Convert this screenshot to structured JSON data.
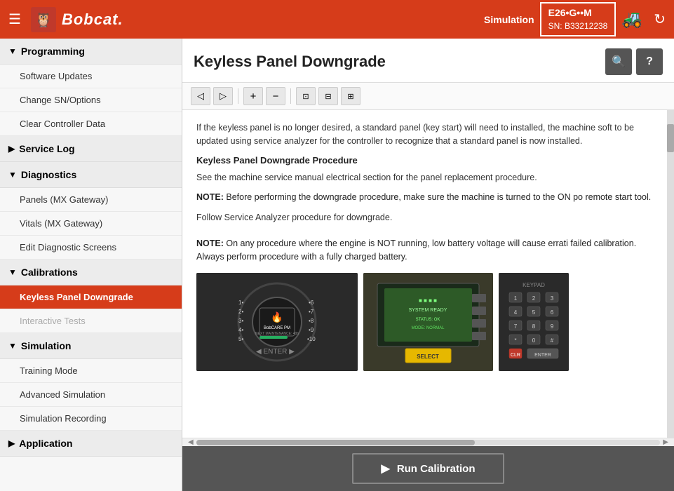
{
  "header": {
    "menu_label": "☰",
    "logo_text": "Bobcat.",
    "sim_label": "Simulation",
    "machine_model": "E26•G••M",
    "machine_sn": "SN: B33212238",
    "refresh_icon": "↻"
  },
  "sidebar": {
    "sections": [
      {
        "id": "programming",
        "label": "Programming",
        "expanded": true,
        "items": [
          {
            "id": "software-updates",
            "label": "Software Updates",
            "active": false,
            "disabled": false
          },
          {
            "id": "change-sn-options",
            "label": "Change SN/Options",
            "active": false,
            "disabled": false
          },
          {
            "id": "clear-controller-data",
            "label": "Clear Controller Data",
            "active": false,
            "disabled": false
          }
        ]
      },
      {
        "id": "service-log",
        "label": "Service Log",
        "expanded": false,
        "items": []
      },
      {
        "id": "diagnostics",
        "label": "Diagnostics",
        "expanded": true,
        "items": [
          {
            "id": "panels-mx-gateway",
            "label": "Panels (MX Gateway)",
            "active": false,
            "disabled": false
          },
          {
            "id": "vitals-mx-gateway",
            "label": "Vitals (MX Gateway)",
            "active": false,
            "disabled": false
          },
          {
            "id": "edit-diagnostic-screens",
            "label": "Edit Diagnostic Screens",
            "active": false,
            "disabled": false
          }
        ]
      },
      {
        "id": "calibrations",
        "label": "Calibrations",
        "expanded": true,
        "items": [
          {
            "id": "keyless-panel-downgrade",
            "label": "Keyless Panel Downgrade",
            "active": true,
            "disabled": false
          },
          {
            "id": "interactive-tests",
            "label": "Interactive Tests",
            "active": false,
            "disabled": true
          }
        ]
      },
      {
        "id": "simulation",
        "label": "Simulation",
        "expanded": true,
        "items": [
          {
            "id": "training-mode",
            "label": "Training Mode",
            "active": false,
            "disabled": false
          },
          {
            "id": "advanced-simulation",
            "label": "Advanced Simulation",
            "active": false,
            "disabled": false
          },
          {
            "id": "simulation-recording",
            "label": "Simulation Recording",
            "active": false,
            "disabled": false
          }
        ]
      },
      {
        "id": "application",
        "label": "Application",
        "expanded": false,
        "items": []
      }
    ]
  },
  "content": {
    "title": "Keyless Panel Downgrade",
    "search_icon": "🔍",
    "help_icon": "?",
    "toolbar": {
      "back_icon": "◁",
      "forward_icon": "▷",
      "zoom_in_icon": "+",
      "zoom_out_icon": "−",
      "fit_page_icon": "⊡",
      "fit_width_icon": "⊟",
      "fit_height_icon": "⊞"
    },
    "body": {
      "intro_text": "If the keyless panel is no longer desired, a standard panel (key start) will need to installed, the machine soft to be updated using service analyzer for the controller to recognize that a standard panel is now installed.",
      "procedure_heading": "Keyless Panel Downgrade Procedure",
      "procedure_text": "See the machine service manual electrical section for the panel replacement procedure.",
      "note1": "NOTE:  Before performing the downgrade procedure, make sure the machine is turned to the ON po remote start tool.",
      "procedure_follow": "Follow Service Analyzer procedure for downgrade.",
      "note2": "NOTE:  On any procedure where the engine is NOT running, low battery voltage will cause errati failed calibration. Always perform procedure with a fully charged battery."
    },
    "run_calibration_btn": "Run Calibration"
  }
}
